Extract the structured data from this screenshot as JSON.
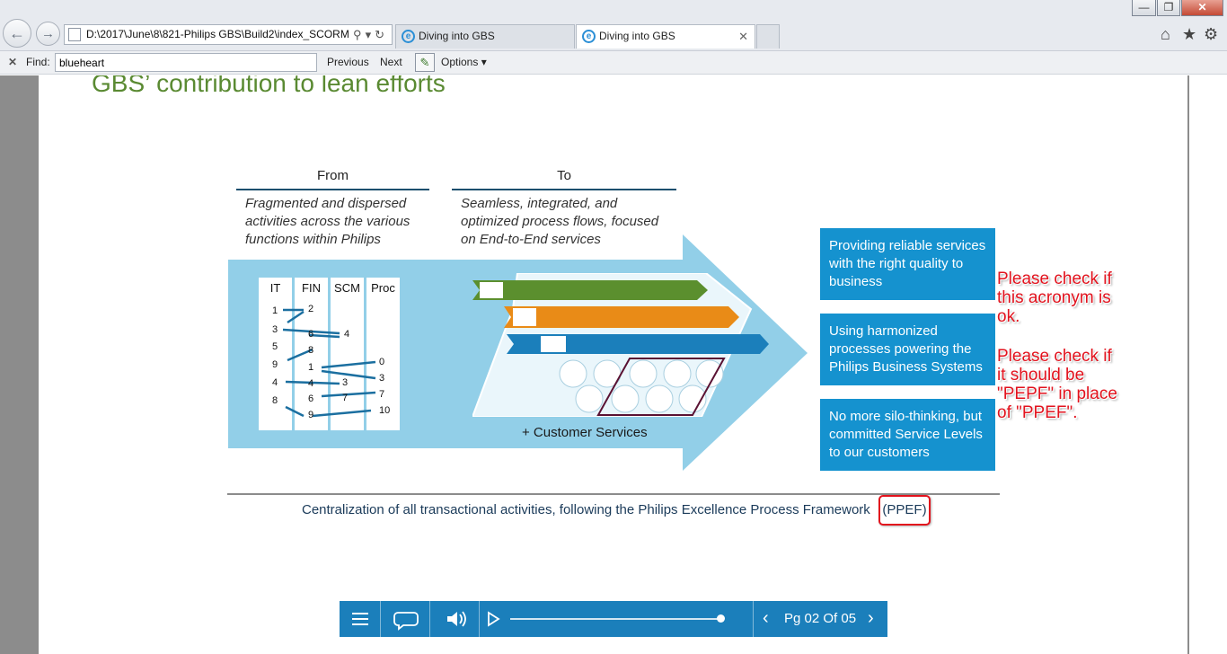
{
  "browser": {
    "address": "D:\\2017\\June\\8\\821-Philips GBS\\Build2\\index_SCORM",
    "tabs": [
      {
        "label": "Diving into GBS",
        "active": false
      },
      {
        "label": "Diving into GBS",
        "active": true
      }
    ],
    "window_buttons": {
      "minimize": "—",
      "maximize": "❐",
      "close": "✕"
    },
    "right_icons": [
      "home-icon",
      "star-icon",
      "gear-icon"
    ]
  },
  "findbar": {
    "close": "✕",
    "label": "Find:",
    "value": "blueheart",
    "previous": "Previous",
    "next": "Next",
    "options": "Options"
  },
  "slide": {
    "title": "GBS’ contribution to lean efforts",
    "from": {
      "heading": "From",
      "text": "Fragmented and dispersed activities across the various functions within Philips"
    },
    "to": {
      "heading": "To",
      "text": "Seamless, integrated, and optimized process flows, focused on End-to-End services"
    },
    "table_headers": [
      "IT",
      "FIN",
      "SCM",
      "Proc"
    ],
    "table_numbers": {
      "it": [
        "1",
        "3",
        "5",
        "9",
        "4",
        "8"
      ],
      "fin": [
        "2",
        "6",
        "8",
        "1",
        "4",
        "6",
        "9"
      ],
      "scm": [
        "4",
        "3",
        "7"
      ],
      "proc": [
        "0",
        "3",
        "7",
        "10"
      ]
    },
    "customer_services": "+ Customer Services",
    "benefits": [
      "Providing reliable services with the right quality to business",
      "Using harmonized processes powering the Philips Business Systems",
      "No more silo-thinking, but committed Service Levels to our customers"
    ],
    "caption": "Centralization of all transactional activities, following the Philips Excellence Process Framework",
    "acronym": "(PPEF)",
    "notes": [
      "Please check if\nthis acronym is\nok.",
      "Please check if\nit should be\n\"PEPF\" in place\nof \"PPEF\"."
    ],
    "colors": {
      "arrow": "#92cfe8",
      "box": "#1592cf",
      "title": "#5a8a32",
      "note": "#e2121d"
    }
  },
  "player": {
    "page_label": "Pg 02 Of 05",
    "progress": 0.99
  }
}
